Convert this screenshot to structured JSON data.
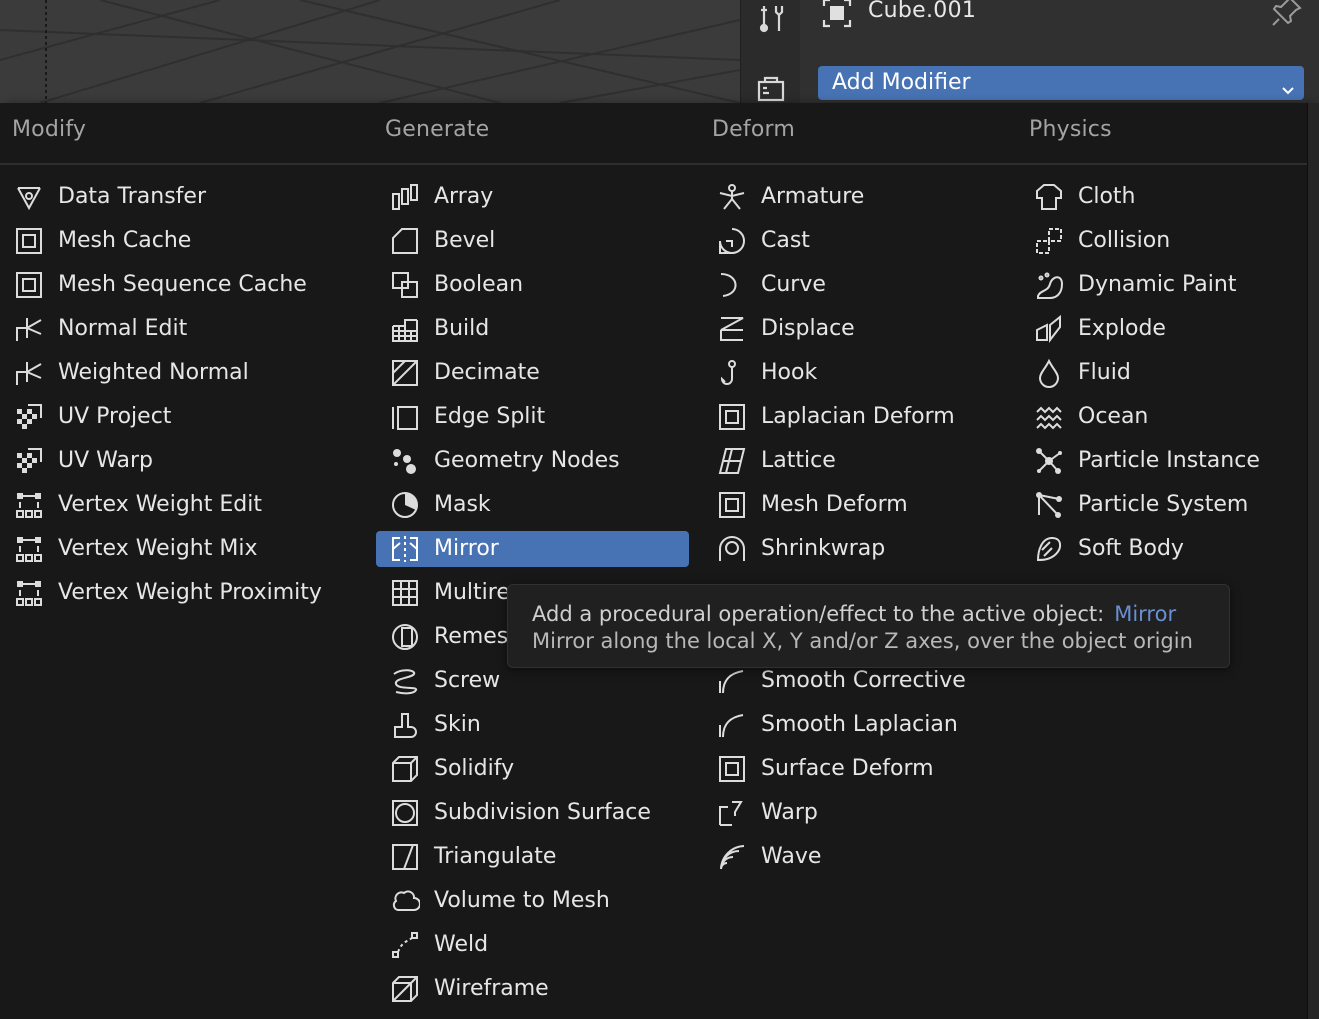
{
  "header": {
    "object_name": "Cube.001",
    "add_modifier_label": "Add Modifier"
  },
  "menu": {
    "columns": [
      {
        "title": "Modify",
        "items": [
          {
            "label": "Data Transfer",
            "icon": "data-transfer-icon"
          },
          {
            "label": "Mesh Cache",
            "icon": "mesh-cache-icon"
          },
          {
            "label": "Mesh Sequence Cache",
            "icon": "mesh-sequence-cache-icon"
          },
          {
            "label": "Normal Edit",
            "icon": "normal-edit-icon"
          },
          {
            "label": "Weighted Normal",
            "icon": "weighted-normal-icon"
          },
          {
            "label": "UV Project",
            "icon": "uv-project-icon"
          },
          {
            "label": "UV Warp",
            "icon": "uv-warp-icon"
          },
          {
            "label": "Vertex Weight Edit",
            "icon": "vertex-weight-edit-icon"
          },
          {
            "label": "Vertex Weight Mix",
            "icon": "vertex-weight-mix-icon"
          },
          {
            "label": "Vertex Weight Proximity",
            "icon": "vertex-weight-proximity-icon"
          }
        ]
      },
      {
        "title": "Generate",
        "items": [
          {
            "label": "Array",
            "icon": "array-icon"
          },
          {
            "label": "Bevel",
            "icon": "bevel-icon"
          },
          {
            "label": "Boolean",
            "icon": "boolean-icon"
          },
          {
            "label": "Build",
            "icon": "build-icon"
          },
          {
            "label": "Decimate",
            "icon": "decimate-icon"
          },
          {
            "label": "Edge Split",
            "icon": "edge-split-icon"
          },
          {
            "label": "Geometry Nodes",
            "icon": "geometry-nodes-icon"
          },
          {
            "label": "Mask",
            "icon": "mask-icon"
          },
          {
            "label": "Mirror",
            "icon": "mirror-icon"
          },
          {
            "label": "Multire",
            "icon": "multiresolution-icon"
          },
          {
            "label": "Remes",
            "icon": "remesh-icon"
          },
          {
            "label": "Screw",
            "icon": "screw-icon"
          },
          {
            "label": "Skin",
            "icon": "skin-icon"
          },
          {
            "label": "Solidify",
            "icon": "solidify-icon"
          },
          {
            "label": "Subdivision Surface",
            "icon": "subdivision-surface-icon"
          },
          {
            "label": "Triangulate",
            "icon": "triangulate-icon"
          },
          {
            "label": "Volume to Mesh",
            "icon": "volume-to-mesh-icon"
          },
          {
            "label": "Weld",
            "icon": "weld-icon"
          },
          {
            "label": "Wireframe",
            "icon": "wireframe-icon"
          }
        ]
      },
      {
        "title": "Deform",
        "items": [
          {
            "label": "Armature",
            "icon": "armature-icon"
          },
          {
            "label": "Cast",
            "icon": "cast-icon"
          },
          {
            "label": "Curve",
            "icon": "curve-icon"
          },
          {
            "label": "Displace",
            "icon": "displace-icon"
          },
          {
            "label": "Hook",
            "icon": "hook-icon"
          },
          {
            "label": "Laplacian Deform",
            "icon": "laplacian-deform-icon"
          },
          {
            "label": "Lattice",
            "icon": "lattice-icon"
          },
          {
            "label": "Mesh Deform",
            "icon": "mesh-deform-icon"
          },
          {
            "label": "Shrinkwrap",
            "icon": "shrinkwrap-icon"
          },
          {
            "label": "",
            "icon": "simple-deform-icon"
          },
          {
            "label": "",
            "icon": "smooth-icon"
          },
          {
            "label": "Smooth Corrective",
            "icon": "smooth-corrective-icon"
          },
          {
            "label": "Smooth Laplacian",
            "icon": "smooth-laplacian-icon"
          },
          {
            "label": "Surface Deform",
            "icon": "surface-deform-icon"
          },
          {
            "label": "Warp",
            "icon": "warp-icon"
          },
          {
            "label": "Wave",
            "icon": "wave-icon"
          }
        ]
      },
      {
        "title": "Physics",
        "items": [
          {
            "label": "Cloth",
            "icon": "cloth-icon"
          },
          {
            "label": "Collision",
            "icon": "collision-icon"
          },
          {
            "label": "Dynamic Paint",
            "icon": "dynamic-paint-icon"
          },
          {
            "label": "Explode",
            "icon": "explode-icon"
          },
          {
            "label": "Fluid",
            "icon": "fluid-icon"
          },
          {
            "label": "Ocean",
            "icon": "ocean-icon"
          },
          {
            "label": "Particle Instance",
            "icon": "particle-instance-icon"
          },
          {
            "label": "Particle System",
            "icon": "particle-system-icon"
          },
          {
            "label": "Soft Body",
            "icon": "soft-body-icon"
          }
        ]
      }
    ],
    "highlighted_item": "Mirror"
  },
  "tooltip": {
    "line1": "Add a procedural operation/effect to the active object:",
    "operation": "Mirror",
    "line2": "Mirror along the local X, Y and/or Z axes, over the object origin"
  },
  "colors": {
    "accent": "#4772b3",
    "menu_bg": "#181818",
    "text": "#e6e6e6",
    "header_text": "#a4a4a4",
    "tooltip_operation": "#6a8fd0"
  }
}
